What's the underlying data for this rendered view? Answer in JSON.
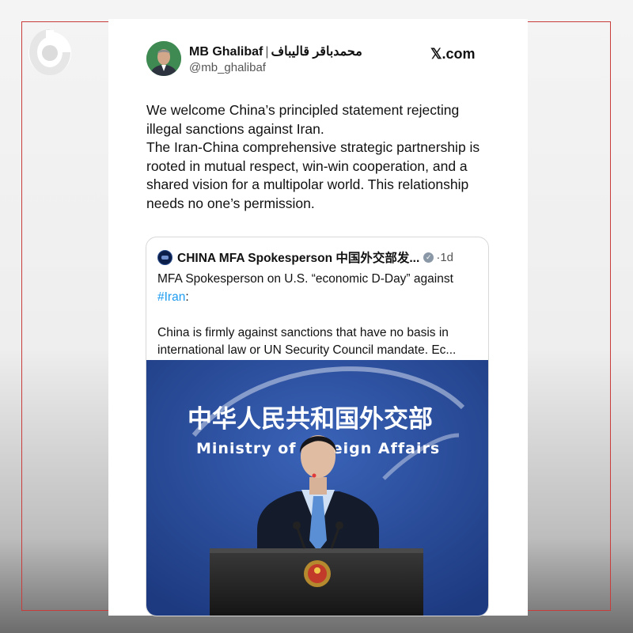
{
  "post": {
    "author_name": "MB Ghalibaf",
    "author_name_fa": "محمدباقر قالیباف",
    "handle": "@mb_ghalibaf",
    "brand": "𝕏.com",
    "text_lines": [
      "We welcome China’s principled statement rejecting illegal sanctions against Iran.",
      "The Iran-China comprehensive strategic partnership is rooted in mutual respect, win-win cooperation, and a shared vision for a multipolar world. This relationship needs no one’s permission."
    ]
  },
  "quoted": {
    "author_name": "CHINA MFA Spokesperson 中国外交部发...",
    "dot": "·",
    "time": "1d",
    "line1": "MFA Spokesperson on U.S. “economic D-Day” against",
    "hashtag": "#Iran",
    "hashtag_suffix": ":",
    "line2": "China is firmly against sanctions that have no basis in international law or UN Security Council mandate. Ec...",
    "photo": {
      "sign_cn": "中华人民共和国外交部",
      "sign_en": "Ministry of Foreign Affairs"
    }
  },
  "colors": {
    "frame": "#c83c3c",
    "hashtag": "#1d9bf0",
    "backdrop_blue": "#2f55a8"
  }
}
